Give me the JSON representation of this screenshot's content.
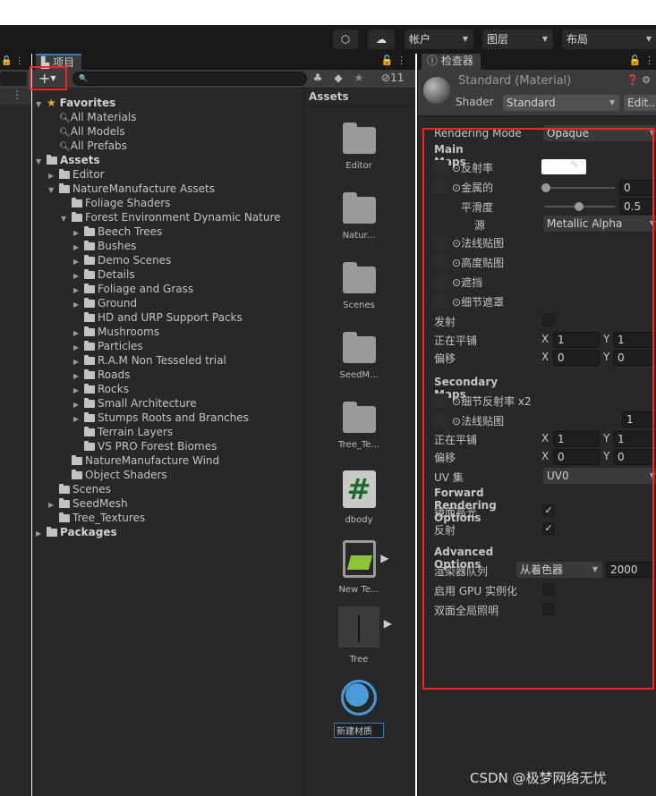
{
  "toolbar": {
    "account": "帐户",
    "layers": "图层",
    "layout": "布局"
  },
  "project": {
    "tab": "项目",
    "hidden_count": "11",
    "assets_header": "Assets",
    "tree": [
      {
        "label": "Favorites",
        "level": 0,
        "bold": true,
        "type": "star",
        "open": true
      },
      {
        "label": "All Materials",
        "level": 1,
        "type": "search"
      },
      {
        "label": "All Models",
        "level": 1,
        "type": "search"
      },
      {
        "label": "All Prefabs",
        "level": 1,
        "type": "search"
      },
      {
        "label": "Assets",
        "level": 0,
        "bold": true,
        "type": "folder",
        "open": true
      },
      {
        "label": "Editor",
        "level": 1,
        "type": "folder",
        "closed": true
      },
      {
        "label": "NatureManufacture Assets",
        "level": 1,
        "type": "folder",
        "open": true
      },
      {
        "label": "Foliage Shaders",
        "level": 2,
        "type": "folder"
      },
      {
        "label": "Forest Environment Dynamic Nature",
        "level": 2,
        "type": "folder",
        "open": true
      },
      {
        "label": "Beech Trees",
        "level": 3,
        "type": "folder",
        "closed": true
      },
      {
        "label": "Bushes",
        "level": 3,
        "type": "folder",
        "closed": true
      },
      {
        "label": "Demo Scenes",
        "level": 3,
        "type": "folder",
        "closed": true
      },
      {
        "label": "Details",
        "level": 3,
        "type": "folder",
        "closed": true
      },
      {
        "label": "Foliage and Grass",
        "level": 3,
        "type": "folder",
        "closed": true
      },
      {
        "label": "Ground",
        "level": 3,
        "type": "folder",
        "closed": true
      },
      {
        "label": "HD and URP Support Packs",
        "level": 3,
        "type": "folder"
      },
      {
        "label": "Mushrooms",
        "level": 3,
        "type": "folder",
        "closed": true
      },
      {
        "label": "Particles",
        "level": 3,
        "type": "folder",
        "closed": true
      },
      {
        "label": "R.A.M Non Tesseled trial",
        "level": 3,
        "type": "folder",
        "closed": true
      },
      {
        "label": "Roads",
        "level": 3,
        "type": "folder",
        "closed": true
      },
      {
        "label": "Rocks",
        "level": 3,
        "type": "folder",
        "closed": true
      },
      {
        "label": "Small Architecture",
        "level": 3,
        "type": "folder",
        "closed": true
      },
      {
        "label": "Stumps Roots and Branches",
        "level": 3,
        "type": "folder",
        "closed": true
      },
      {
        "label": "Terrain Layers",
        "level": 3,
        "type": "folder"
      },
      {
        "label": "VS PRO Forest Biomes",
        "level": 3,
        "type": "folder"
      },
      {
        "label": "NatureManufacture Wind",
        "level": 2,
        "type": "folder"
      },
      {
        "label": "Object Shaders",
        "level": 2,
        "type": "folder"
      },
      {
        "label": "Scenes",
        "level": 1,
        "type": "folder"
      },
      {
        "label": "SeedMesh",
        "level": 1,
        "type": "folder",
        "closed": true
      },
      {
        "label": "Tree_Textures",
        "level": 1,
        "type": "folder"
      },
      {
        "label": "Packages",
        "level": 0,
        "bold": true,
        "type": "folder",
        "closed": true
      }
    ],
    "grid": [
      {
        "label": "Editor",
        "icon": "folder"
      },
      {
        "label": "Natur...",
        "icon": "folder"
      },
      {
        "label": "Scenes",
        "icon": "folder"
      },
      {
        "label": "SeedM...",
        "icon": "folder"
      },
      {
        "label": "Tree_Te...",
        "icon": "folder"
      },
      {
        "label": "dbody",
        "icon": "csharp-script"
      },
      {
        "label": "New Te...",
        "icon": "terrain-data"
      },
      {
        "label": "Tree",
        "icon": "tree-prefab"
      },
      {
        "label": "新建材质",
        "icon": "material",
        "renaming": true
      }
    ]
  },
  "inspector": {
    "tab": "检查器",
    "title": "Standard (Material)",
    "shader_label": "Shader",
    "shader_value": "Standard",
    "edit_label": "Edit...",
    "rendering_mode_label": "Rendering Mode",
    "rendering_mode": "Opaque",
    "main_maps": "Main Maps",
    "albedo": "反射率",
    "metallic": "金属的",
    "metallic_value": "0",
    "smoothness": "平滑度",
    "smoothness_value": "0.5",
    "source": "源",
    "source_value": "Metallic Alpha",
    "normal": "法线贴图",
    "height": "高度贴图",
    "occlusion": "遮挡",
    "detail_mask": "细节遮罩",
    "emission": "发射",
    "tiling": "正在平铺",
    "offset": "偏移",
    "x": "X",
    "y": "Y",
    "tiling_x": "1",
    "tiling_y": "1",
    "offset_x": "0",
    "offset_y": "0",
    "secondary_maps": "Secondary Maps",
    "detail_albedo": "细节反射率 x2",
    "detail_normal": "法线贴图",
    "detail_normal_value": "1",
    "sec_tiling_x": "1",
    "sec_tiling_y": "1",
    "sec_offset_x": "0",
    "sec_offset_y": "0",
    "uv_set": "UV 集",
    "uv_set_value": "UV0",
    "forward": "Forward Rendering Options",
    "specular": "镜面高光",
    "reflections": "反射",
    "advanced": "Advanced Options",
    "render_queue": "渲染器队列",
    "render_queue_mode": "从着色器",
    "render_queue_value": "2000",
    "gpu_instancing": "启用 GPU 实例化",
    "double_sided_gi": "双面全局照明"
  },
  "watermark": "CSDN @极梦网络无忧",
  "colors": {
    "highlight": "#ff2020",
    "accent": "#3a79bb"
  }
}
